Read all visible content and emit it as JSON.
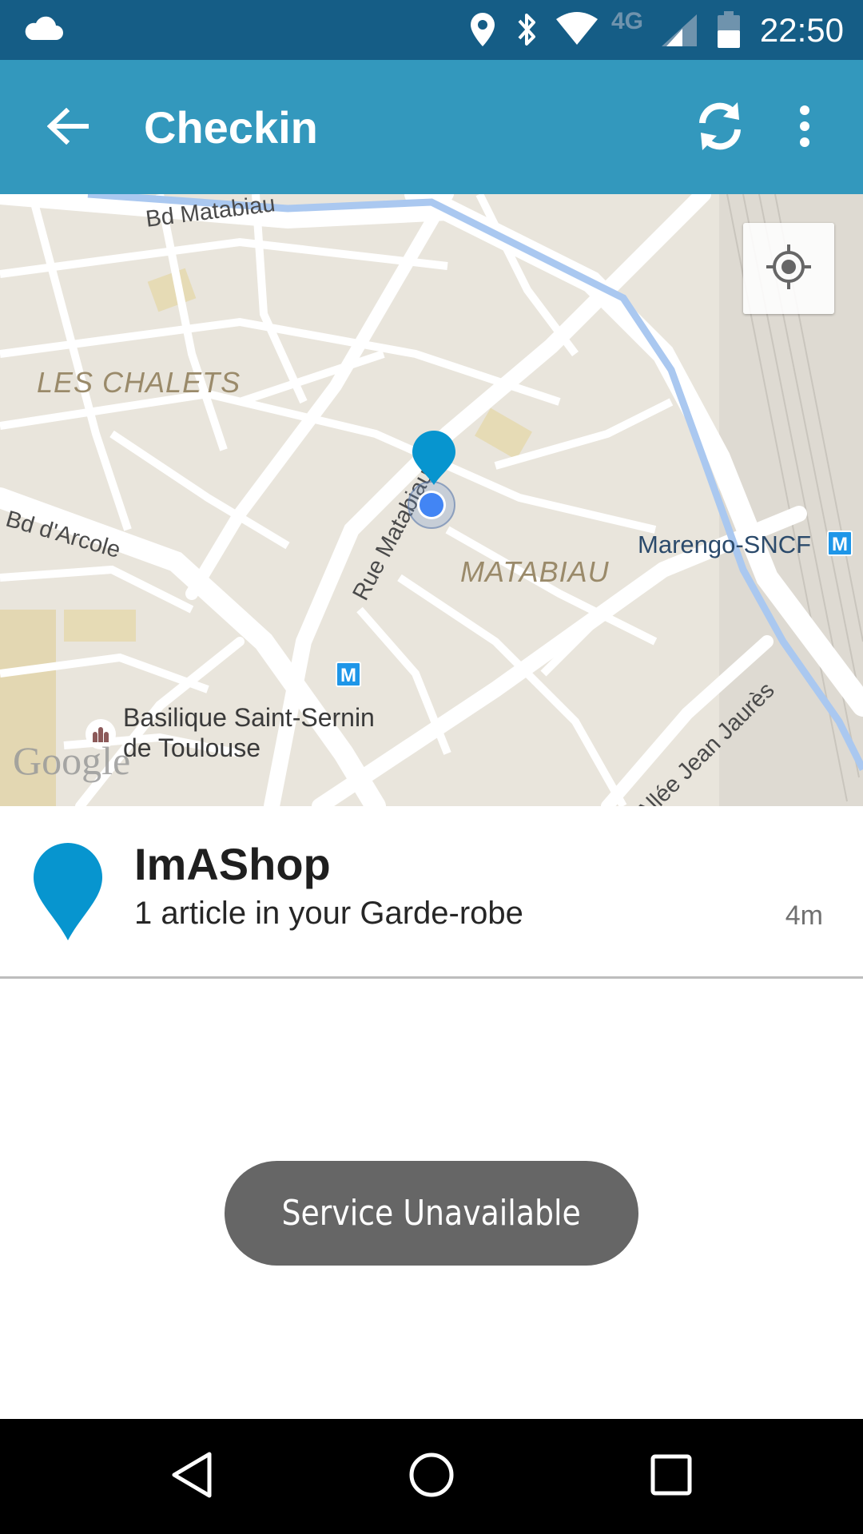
{
  "status_bar": {
    "time": "22:50",
    "network": "4G",
    "icons": [
      "cloud-icon",
      "location-icon",
      "bluetooth-icon",
      "wifi-icon",
      "signal-icon",
      "battery-icon"
    ]
  },
  "app_bar": {
    "title": "Checkin",
    "back_icon": "arrow-back-icon",
    "refresh_icon": "refresh-icon",
    "menu_icon": "more-vert-icon",
    "background_color": "#3398bd"
  },
  "map": {
    "labels": {
      "bd_matabiau": "Bd Matabiau",
      "les_chalets": "LES CHALETS",
      "bd_arcole": "Bd d'Arcole",
      "rue_matabiau": "Rue Matabiau",
      "matabiau": "MATABIAU",
      "marengo": "Marengo-SNCF",
      "basilique_line1": "Basilique Saint-Sernin",
      "basilique_line2": "de Toulouse",
      "allee_jaures": "Allée Jean Jaurès",
      "metro": "M"
    },
    "attribution": "Google",
    "locate_icon": "my-location-icon"
  },
  "shop": {
    "name": "ImAShop",
    "description": "1 article in your Garde-robe",
    "time": "4m",
    "pin_color": "#0795cf"
  },
  "toast": {
    "message": "Service Unavailable"
  },
  "nav_bar": {
    "back_icon": "nav-back-icon",
    "home_icon": "nav-home-icon",
    "recents_icon": "nav-recents-icon"
  }
}
